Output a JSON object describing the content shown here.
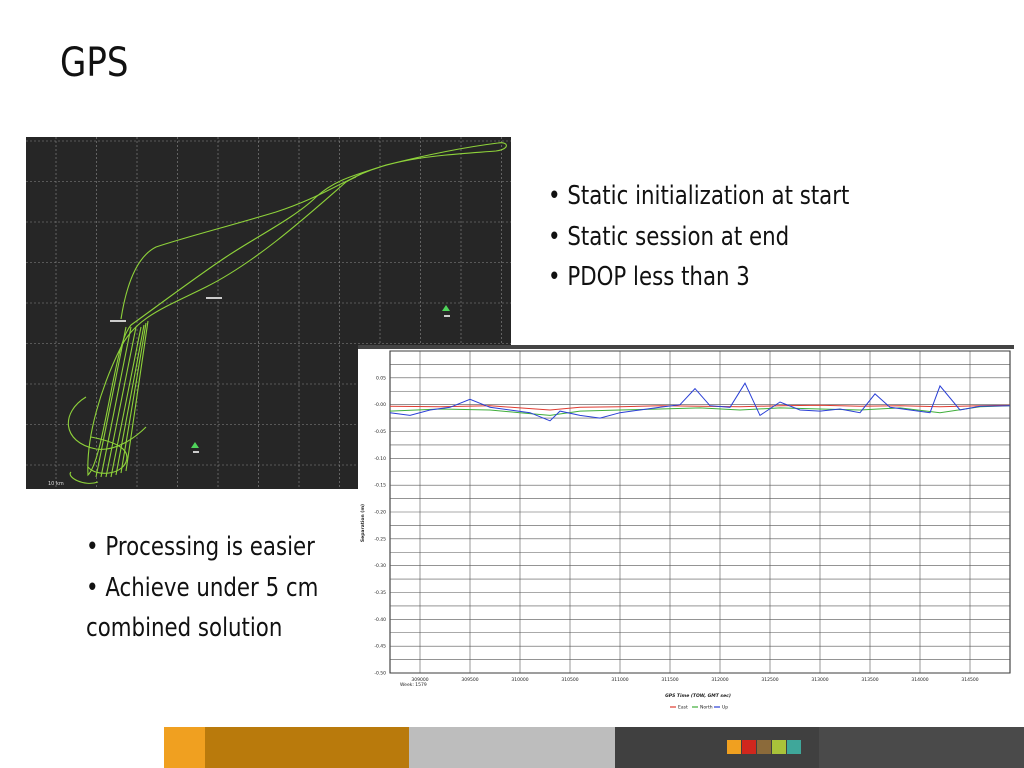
{
  "slide": {
    "title": "GPS",
    "bullets_right": [
      "• Static initialization at start",
      "• Static session at end",
      "• PDOP less than 3"
    ],
    "bullets_left": [
      "• Processing is easier",
      "• Achieve under 5 cm",
      "combined solution"
    ]
  },
  "track_map": {
    "scale_label": "10 km",
    "colors": {
      "background": "#262626",
      "grid": "#8a8a8a",
      "track": "#8ed23a",
      "marker": "#4fd45a"
    }
  },
  "chart_data": {
    "type": "line",
    "xlabel": "GPS Time (TOW, GMT sec)",
    "ylabel": "Separation (m)",
    "xlim": [
      308700,
      314900
    ],
    "ylim": [
      -0.5,
      0.1
    ],
    "x_ticks": [
      "309000",
      "309500",
      "310000",
      "310500",
      "311000",
      "311500",
      "312000",
      "312500",
      "313000",
      "313500",
      "314000",
      "314500"
    ],
    "x_tick_values": [
      309000,
      309500,
      310000,
      310500,
      311000,
      311500,
      312000,
      312500,
      313000,
      313500,
      314000,
      314500
    ],
    "x_sublabel": "Week: 1579",
    "y_ticks": [
      "0.10",
      "0.05",
      "-0.00",
      "-0.05",
      "-0.10",
      "-0.15",
      "-0.20",
      "-0.25",
      "-0.30",
      "-0.35",
      "-0.40",
      "-0.45",
      "-0.50"
    ],
    "y_tick_values": [
      0.1,
      0.05,
      0.0,
      -0.05,
      -0.1,
      -0.15,
      -0.2,
      -0.25,
      -0.3,
      -0.35,
      -0.4,
      -0.45,
      -0.5
    ],
    "grid": true,
    "legend_position": "bottom-center",
    "series": [
      {
        "name": "East",
        "color": "#e03c31",
        "x": [
          308700,
          309200,
          309700,
          310000,
          310300,
          310600,
          311000,
          311400,
          311800,
          312200,
          312600,
          313000,
          313400,
          313800,
          314200,
          314600,
          314900
        ],
        "values": [
          -0.003,
          -0.004,
          -0.002,
          -0.006,
          -0.01,
          -0.005,
          -0.004,
          -0.002,
          -0.003,
          -0.004,
          -0.002,
          -0.001,
          -0.003,
          -0.002,
          -0.004,
          -0.002,
          -0.001
        ]
      },
      {
        "name": "North",
        "color": "#3fae3a",
        "x": [
          308700,
          309200,
          309700,
          310000,
          310300,
          310600,
          311000,
          311400,
          311800,
          312200,
          312600,
          313000,
          313400,
          313800,
          314200,
          314600,
          314900
        ],
        "values": [
          -0.012,
          -0.008,
          -0.01,
          -0.015,
          -0.02,
          -0.012,
          -0.01,
          -0.008,
          -0.006,
          -0.01,
          -0.006,
          -0.008,
          -0.01,
          -0.006,
          -0.015,
          -0.004,
          -0.002
        ]
      },
      {
        "name": "Up",
        "color": "#2a3fd6",
        "x": [
          308700,
          308900,
          309100,
          309300,
          309500,
          309700,
          309900,
          310100,
          310300,
          310400,
          310600,
          310800,
          311000,
          311200,
          311400,
          311600,
          311750,
          311900,
          312100,
          312250,
          312400,
          312600,
          312800,
          313000,
          313200,
          313400,
          313550,
          313700,
          313900,
          314100,
          314200,
          314400,
          314600,
          314900
        ],
        "values": [
          -0.015,
          -0.02,
          -0.01,
          -0.005,
          0.01,
          -0.005,
          -0.01,
          -0.015,
          -0.03,
          -0.012,
          -0.02,
          -0.025,
          -0.015,
          -0.01,
          -0.005,
          0.0,
          0.03,
          -0.002,
          -0.005,
          0.04,
          -0.02,
          0.005,
          -0.01,
          -0.012,
          -0.008,
          -0.015,
          0.02,
          -0.005,
          -0.01,
          -0.015,
          0.035,
          -0.01,
          -0.003,
          -0.002
        ]
      }
    ]
  },
  "footer": {
    "colors": [
      "#f0a020",
      "#b97a0c",
      "#bdbdbd",
      "#404040",
      "#4a4a4a"
    ],
    "swatches": [
      "#f0a020",
      "#d0271d",
      "#8b6a3a",
      "#a9c23a",
      "#3fa79a"
    ]
  }
}
